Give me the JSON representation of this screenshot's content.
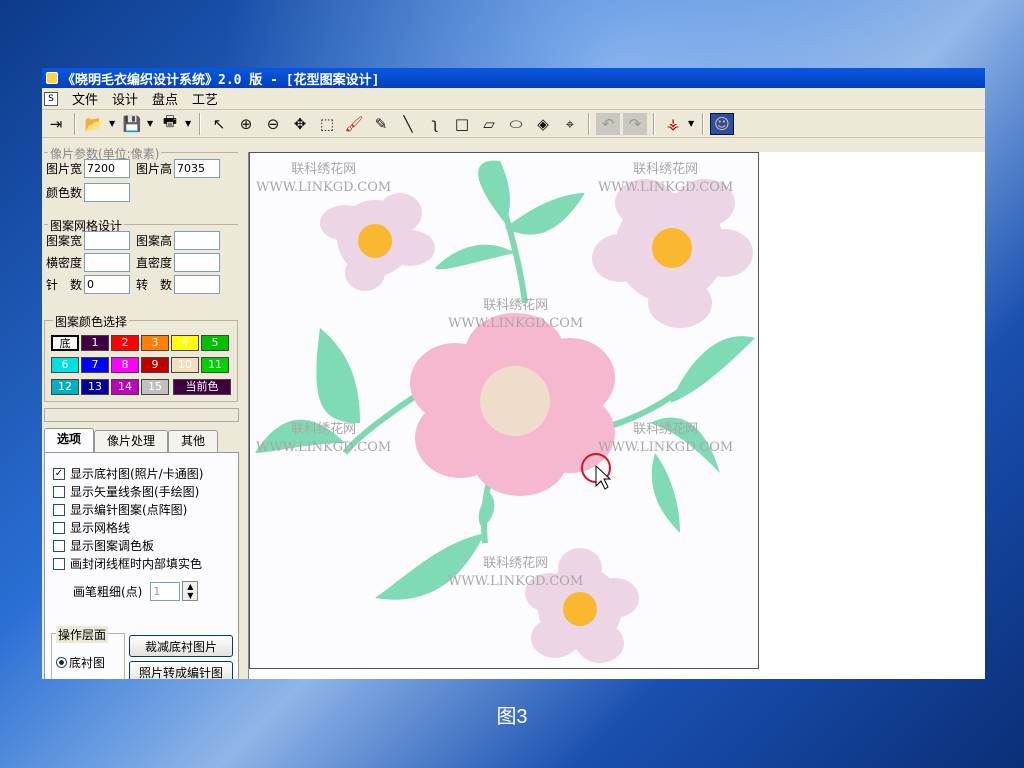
{
  "window": {
    "title": "《晓明毛衣编织设计系统》2.0 版 - [花型图案设计]"
  },
  "menu": [
    "文件",
    "设计",
    "盘点",
    "工艺"
  ],
  "toolbar_icons": [
    "exit-icon",
    "open-folder-icon",
    "save-icon",
    "print-icon",
    "select-arrow-icon",
    "zoom-in-icon",
    "zoom-out-icon",
    "move-icon",
    "rect-select-icon",
    "brush-icon",
    "pencil-icon",
    "line-icon",
    "curve-icon",
    "rectangle-icon",
    "parallelogram-icon",
    "ellipse-icon",
    "fill-icon",
    "crop-icon",
    "undo-icon",
    "redo-icon",
    "symmetry-icon",
    "avatar-icon"
  ],
  "pixel_params": {
    "title": "像片参数(单位:像素)",
    "width_label": "图片宽",
    "width_value": "7200",
    "height_label": "图片高",
    "height_value": "7035",
    "colors_label": "颜色数",
    "colors_value": ""
  },
  "grid_design": {
    "title": "图案网格设计",
    "pw_label": "图案宽",
    "ph_label": "图案高",
    "hd_label": "横密度",
    "vd_label": "直密度",
    "needle_label": "针　数",
    "needle_value": "0",
    "turn_label": "转　数"
  },
  "palette": {
    "title": "图案颜色选择",
    "items": [
      {
        "label": "底",
        "color": "#ffffff",
        "text": "#000000"
      },
      {
        "label": "1",
        "color": "#400040",
        "text": "#ffffff"
      },
      {
        "label": "2",
        "color": "#ff0000",
        "text": "#ffffff"
      },
      {
        "label": "3",
        "color": "#ff8000",
        "text": "#ffffff"
      },
      {
        "label": "4",
        "color": "#ffff00",
        "text": "#ffffff"
      },
      {
        "label": "5",
        "color": "#00c000",
        "text": "#ffffff"
      },
      {
        "label": "6",
        "color": "#00e0e0",
        "text": "#ffffff"
      },
      {
        "label": "7",
        "color": "#0000ff",
        "text": "#ffffff"
      },
      {
        "label": "8",
        "color": "#ff00ff",
        "text": "#ffffff"
      },
      {
        "label": "9",
        "color": "#c00000",
        "text": "#ffffff"
      },
      {
        "label": "10",
        "color": "#f0e0c0",
        "text": "#ffffff"
      },
      {
        "label": "11",
        "color": "#00d000",
        "text": "#ffffff"
      },
      {
        "label": "12",
        "color": "#00b0c0",
        "text": "#ffffff"
      },
      {
        "label": "13",
        "color": "#0000a0",
        "text": "#ffffff"
      },
      {
        "label": "14",
        "color": "#c000c0",
        "text": "#ffffff"
      },
      {
        "label": "15",
        "color": "#c0c0c0",
        "text": "#ffffff"
      }
    ],
    "current_label": "当前色",
    "current_color": "#400040"
  },
  "tabs": [
    "选项",
    "像片处理",
    "其他"
  ],
  "options": [
    {
      "label": "显示底衬图(照片/卡通图)",
      "checked": true
    },
    {
      "label": "显示矢量线条图(手绘图)",
      "checked": false
    },
    {
      "label": "显示编针图案(点阵图)",
      "checked": false
    },
    {
      "label": "显示网格线",
      "checked": false
    },
    {
      "label": "显示图案调色板",
      "checked": false
    },
    {
      "label": "画封闭线框时内部填实色",
      "checked": false
    }
  ],
  "pen": {
    "label": "画笔粗细(点)",
    "value": "1"
  },
  "layer": {
    "title": "操作层面",
    "radio_label": "底衬图"
  },
  "buttons": {
    "crop": "裁减底衬图片",
    "convert": "照片转成编针图"
  },
  "watermark": {
    "line1": "联科绣花网",
    "line2": "WWW.LINKGD.COM"
  },
  "caption": "图3"
}
